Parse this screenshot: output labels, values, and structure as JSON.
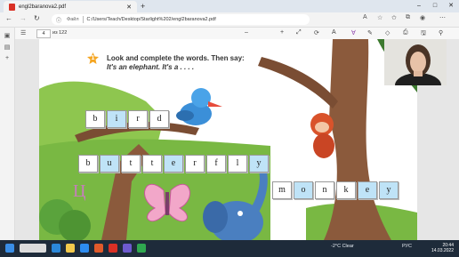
{
  "browser": {
    "tab_title": "engl2baranova2.pdf",
    "file_label": "Файл",
    "url": "C:/Users/Teach/Desktop/Starlight%202/engl2baranova2.pdf",
    "window_controls": [
      "–",
      "□",
      "✕"
    ],
    "new_tab": "+"
  },
  "pdf_toolbar": {
    "page_current": "4",
    "page_total": "из 122",
    "zoom_minus": "–",
    "zoom_plus": "+"
  },
  "page": {
    "task_number": "1",
    "task_title": "Look and complete the words. Then say:",
    "task_sub": "It's an elephant. It's a . . . .",
    "scribble": "Ц"
  },
  "words": {
    "bird": [
      "b",
      "i",
      "r",
      "d"
    ],
    "butterfly": [
      "b",
      "u",
      "t",
      "t",
      "e",
      "r",
      "f",
      "l",
      "y"
    ],
    "monkey": [
      "m",
      "o",
      "n",
      "k",
      "e",
      "y"
    ]
  },
  "taskbar": {
    "weather": "-2°C  Clear",
    "lang": "РУС",
    "time": "20:44",
    "date": "14.03.2022"
  },
  "colors": {
    "sky_blue": "#bfe3f7",
    "grass_green": "#6ab04c",
    "tree_brown": "#8b5a3c",
    "taskbar": "#1e2b3a"
  }
}
